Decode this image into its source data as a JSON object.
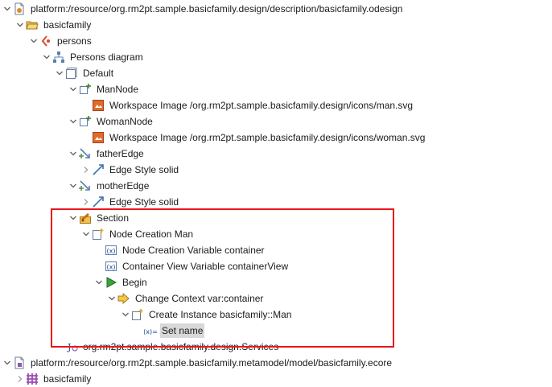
{
  "tree": [
    {
      "name": "resource-odesign-node",
      "depth": 0,
      "toggle": "expanded",
      "icon": "odesign-resource-icon",
      "label": "platform:/resource/org.rm2pt.sample.basicfamily.design/description/basicfamily.odesign"
    },
    {
      "name": "group-basicfamily-node",
      "depth": 1,
      "toggle": "expanded",
      "icon": "folder-open-icon",
      "label": "basicfamily"
    },
    {
      "name": "viewpoint-persons-node",
      "depth": 2,
      "toggle": "expanded",
      "icon": "viewpoint-icon",
      "label": "persons"
    },
    {
      "name": "diagram-persons-node",
      "depth": 3,
      "toggle": "expanded",
      "icon": "diagram-icon",
      "label": "Persons diagram"
    },
    {
      "name": "layer-default-node",
      "depth": 4,
      "toggle": "expanded",
      "icon": "layer-icon",
      "label": "Default"
    },
    {
      "name": "node-mannode",
      "depth": 5,
      "toggle": "expanded",
      "icon": "node-mapping-icon",
      "label": "ManNode"
    },
    {
      "name": "style-man-image-node",
      "depth": 6,
      "toggle": "none",
      "icon": "workspace-image-icon",
      "label": "Workspace Image /org.rm2pt.sample.basicfamily.design/icons/man.svg"
    },
    {
      "name": "node-womannode",
      "depth": 5,
      "toggle": "expanded",
      "icon": "node-mapping-icon",
      "label": "WomanNode"
    },
    {
      "name": "style-woman-image-node",
      "depth": 6,
      "toggle": "none",
      "icon": "workspace-image-icon",
      "label": "Workspace Image /org.rm2pt.sample.basicfamily.design/icons/woman.svg"
    },
    {
      "name": "edge-fatheredge-node",
      "depth": 5,
      "toggle": "expanded",
      "icon": "edge-mapping-icon",
      "label": "fatherEdge"
    },
    {
      "name": "edge-style-father-node",
      "depth": 6,
      "toggle": "collapsed",
      "icon": "edge-style-icon",
      "label": "Edge Style solid"
    },
    {
      "name": "edge-motheredge-node",
      "depth": 5,
      "toggle": "expanded",
      "icon": "edge-mapping-icon",
      "label": "motherEdge"
    },
    {
      "name": "edge-style-mother-node",
      "depth": 6,
      "toggle": "collapsed",
      "icon": "edge-style-icon",
      "label": "Edge Style solid"
    },
    {
      "name": "section-node",
      "depth": 5,
      "toggle": "expanded",
      "icon": "section-icon",
      "label": "Section"
    },
    {
      "name": "node-creation-man-node",
      "depth": 6,
      "toggle": "expanded",
      "icon": "node-creation-icon",
      "label": "Node Creation Man"
    },
    {
      "name": "variable-container-node",
      "depth": 7,
      "toggle": "none",
      "icon": "variable-icon",
      "label": "Node Creation Variable container"
    },
    {
      "name": "variable-containerview-node",
      "depth": 7,
      "toggle": "none",
      "icon": "variable-icon",
      "label": "Container View Variable containerView"
    },
    {
      "name": "begin-node",
      "depth": 7,
      "toggle": "expanded",
      "icon": "begin-icon",
      "label": "Begin"
    },
    {
      "name": "change-context-node",
      "depth": 8,
      "toggle": "expanded",
      "icon": "change-context-icon",
      "label": "Change Context var:container"
    },
    {
      "name": "create-instance-node",
      "depth": 9,
      "toggle": "expanded",
      "icon": "create-instance-icon",
      "label": "Create Instance basicfamily::Man"
    },
    {
      "name": "set-name-node",
      "depth": 10,
      "toggle": "none",
      "icon": "set-value-icon",
      "label": "Set name",
      "selected": true
    },
    {
      "name": "java-services-node",
      "depth": 4,
      "toggle": "none",
      "icon": "java-extension-icon",
      "label": "org.rm2pt.sample.basicfamily.design.Services"
    },
    {
      "name": "resource-ecore-node",
      "depth": 0,
      "toggle": "expanded",
      "icon": "ecore-resource-icon",
      "label": "platform:/resource/org.rm2pt.sample.basicfamily.metamodel/model/basicfamily.ecore"
    },
    {
      "name": "package-basicfamily-node",
      "depth": 1,
      "toggle": "collapsed",
      "icon": "epackage-icon",
      "label": "basicfamily"
    }
  ],
  "colors": {
    "highlight_border": "#e8161b",
    "selection": "#d8d8d8",
    "toggle": "#606060"
  }
}
